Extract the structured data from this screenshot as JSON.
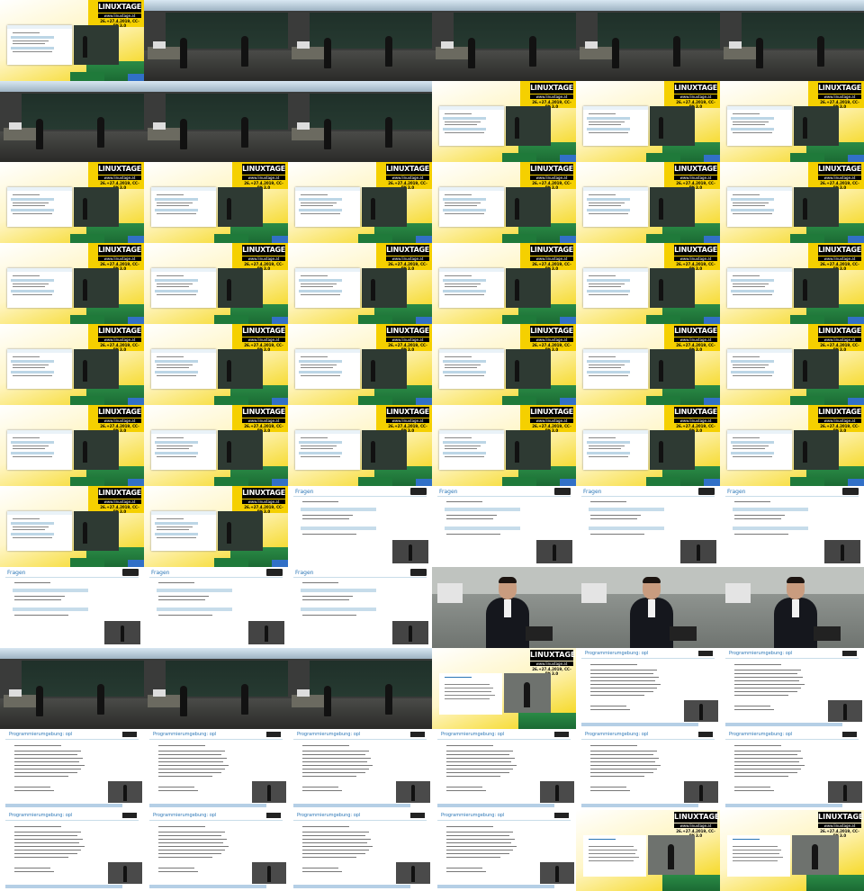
{
  "sheet": {
    "columns": 6,
    "rows": 11,
    "thumb_order": [
      "overlay_slide",
      "hall",
      "hall",
      "hall",
      "hall",
      "hall",
      "hall",
      "hall",
      "hall",
      "overlay_slide",
      "overlay_slide",
      "overlay_slide",
      "overlay_slide",
      "overlay_slide",
      "overlay_slide",
      "overlay_slide",
      "overlay_slide",
      "overlay_slide",
      "overlay_slide",
      "overlay_slide",
      "overlay_slide",
      "overlay_slide",
      "overlay_slide",
      "overlay_slide",
      "overlay_slide",
      "overlay_slide",
      "overlay_slide",
      "overlay_slide",
      "overlay_slide",
      "overlay_slide",
      "overlay_slide",
      "overlay_slide",
      "overlay_slide",
      "overlay_slide",
      "overlay_slide",
      "overlay_slide",
      "overlay_slide",
      "overlay_slide",
      "slide_fragen",
      "slide_fragen",
      "slide_fragen",
      "slide_fragen",
      "slide_fragen",
      "slide_fragen",
      "slide_fragen",
      "closeup",
      "closeup",
      "closeup",
      "hall",
      "hall",
      "hall",
      "overlay_prog",
      "slide_prog",
      "slide_prog",
      "slide_prog",
      "slide_prog",
      "slide_prog",
      "slide_prog",
      "slide_prog",
      "slide_prog",
      "slide_prog",
      "slide_prog",
      "slide_prog",
      "slide_prog",
      "overlay_prog",
      "overlay_prog"
    ]
  },
  "overlay": {
    "logo_text": "LINUXTAGE",
    "url_text": "www.linuxtage.at",
    "date_text": "26.+27.4.2019, CC-BY 3.0"
  },
  "slides": {
    "fragen_title": "Fragen",
    "prog_title": "Programmierumgebung: opl"
  },
  "colors": {
    "accent_yellow": "#f3d200",
    "accent_blue": "#2b76b6",
    "chalkboard": "#1f3029"
  }
}
